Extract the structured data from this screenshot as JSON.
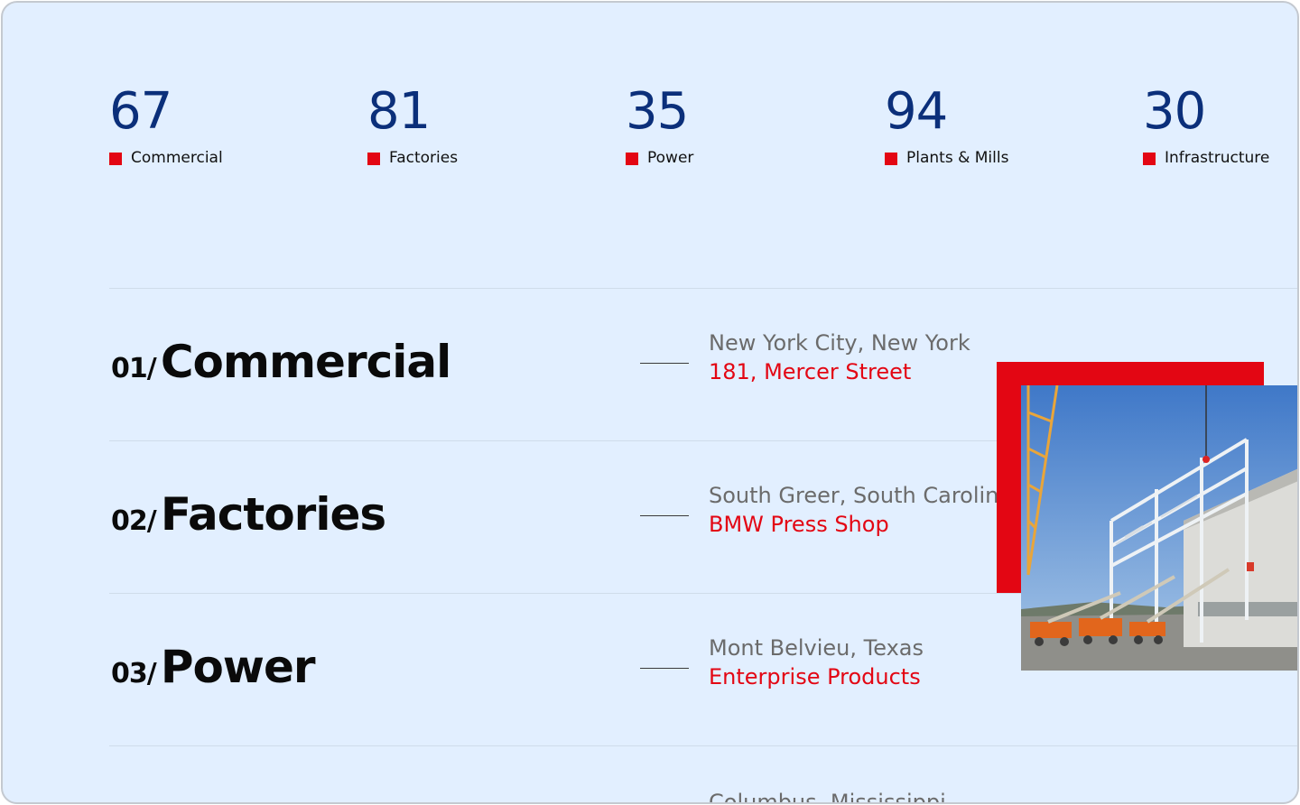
{
  "stats": [
    {
      "value": "67",
      "label": "Commercial"
    },
    {
      "value": "81",
      "label": "Factories"
    },
    {
      "value": "35",
      "label": "Power"
    },
    {
      "value": "94",
      "label": "Plants & Mills"
    },
    {
      "value": "30",
      "label": "Infrastructure"
    }
  ],
  "sectors": [
    {
      "index": "01/",
      "name": "Commercial",
      "location": "New York City, New York",
      "project": "181, Mercer Street"
    },
    {
      "index": "02/",
      "name": "Factories",
      "location": "South Greer, South Carolina",
      "project": "BMW Press Shop"
    },
    {
      "index": "03/",
      "name": "Power",
      "location": "Mont Belvieu, Texas",
      "project": "Enterprise Products"
    },
    {
      "location": "Columbus, Mississippi"
    }
  ],
  "colors": {
    "accent": "#e30613",
    "stat_number": "#0b2f7a",
    "background": "#e2efff"
  },
  "icons": {
    "stat_marker": "red-square-icon"
  },
  "image": {
    "subject": "steel-frame-construction-site-photo"
  }
}
